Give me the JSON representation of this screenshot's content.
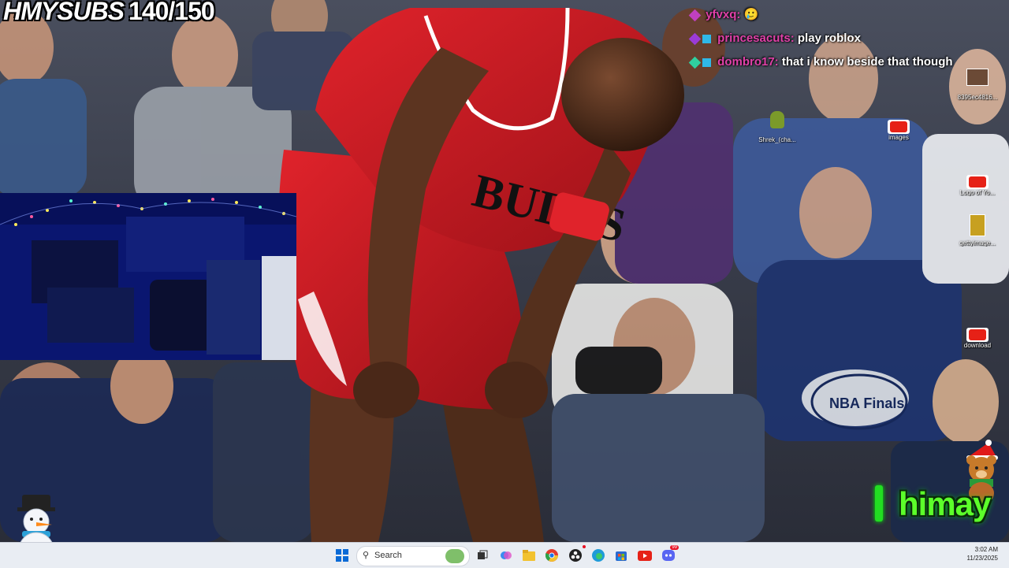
{
  "overlay": {
    "sub_goal_label": "HMYSUBS",
    "sub_goal_count": "140/150",
    "channel_name": "himay"
  },
  "chat": [
    {
      "user": "yfvxq:",
      "message": "🥲",
      "badge_color": "#c040c0"
    },
    {
      "user": "princesacuts:",
      "message": "play roblox",
      "badge_color": "#9b3bd6"
    },
    {
      "user": "dombro17:",
      "message": "that i know beside that though",
      "badge_color": "#2fb8e8"
    }
  ],
  "desktop_icons": [
    {
      "label": "8395ec4816...",
      "icon": "image-file-icon"
    },
    {
      "label": "Shrek_(cha...",
      "icon": "shrek-image-icon"
    },
    {
      "label": "images",
      "icon": "youtube-icon"
    },
    {
      "label": "Logo of Yo...",
      "icon": "youtube-icon"
    },
    {
      "label": "gettyimage...",
      "icon": "image-file-icon"
    },
    {
      "label": "download",
      "icon": "youtube-icon"
    }
  ],
  "taskbar": {
    "search_placeholder": "Search",
    "time": "3:02 AM",
    "date": "11/23/2025",
    "discord_badge": "99"
  },
  "colors": {
    "chat_name": "#e040a8",
    "channel_green": "#5cff2a",
    "jersey_red": "#c8171f",
    "taskbar_bg": "#e9edf3"
  }
}
